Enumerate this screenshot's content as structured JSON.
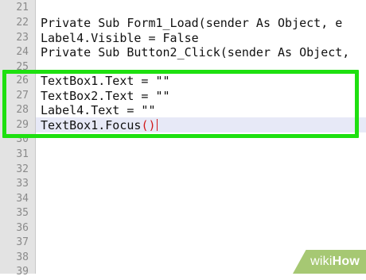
{
  "editor": {
    "lines": [
      {
        "number": "21",
        "text": ""
      },
      {
        "number": "22",
        "text": "Private Sub Form1_Load(sender As Object, e"
      },
      {
        "number": "23",
        "text": "Label4.Visible = False"
      },
      {
        "number": "24",
        "text": "Private Sub Button2_Click(sender As Object,"
      },
      {
        "number": "25",
        "text": ""
      },
      {
        "number": "26",
        "text": "TextBox1.Text = \"\""
      },
      {
        "number": "27",
        "text": "TextBox2.Text = \"\""
      },
      {
        "number": "28",
        "text": "Label4.Text = \"\""
      },
      {
        "number": "29",
        "text": "TextBox1.Focus",
        "suffix": "()"
      },
      {
        "number": "30",
        "text": ""
      },
      {
        "number": "31",
        "text": ""
      },
      {
        "number": "32",
        "text": ""
      },
      {
        "number": "33",
        "text": ""
      },
      {
        "number": "34",
        "text": ""
      },
      {
        "number": "35",
        "text": ""
      },
      {
        "number": "36",
        "text": ""
      },
      {
        "number": "37",
        "text": ""
      },
      {
        "number": "38",
        "text": ""
      },
      {
        "number": "39",
        "text": ""
      }
    ]
  },
  "watermark": {
    "part1": "wiki",
    "part2": "How"
  },
  "colors": {
    "highlight": "#1ee010",
    "paren": "#d11a1a",
    "gutter": "#e3e3e3"
  }
}
